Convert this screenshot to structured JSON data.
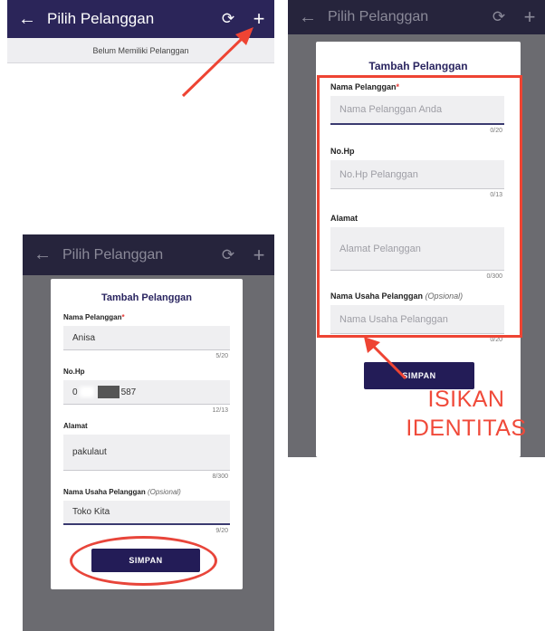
{
  "appbar": {
    "title": "Pilih Pelanggan",
    "back_icon": "←",
    "refresh_icon": "⟳",
    "add_icon": "+"
  },
  "empty_state": "Belum Memiliki Pelanggan",
  "dialog": {
    "title": "Tambah Pelanggan",
    "fields": [
      {
        "label": "Nama Pelanggan",
        "required_mark": "*",
        "placeholder": "Nama Pelanggan Anda",
        "counter_empty": "0/20"
      },
      {
        "label": "No.Hp",
        "placeholder": "No.Hp Pelanggan",
        "counter_empty": "0/13"
      },
      {
        "label": "Alamat",
        "placeholder": "Alamat Pelanggan",
        "counter_empty": "0/300"
      },
      {
        "label": "Nama Usaha Pelanggan",
        "optional_note": "(Opsional)",
        "placeholder": "Nama Usaha Pelanggan",
        "counter_empty": "0/20"
      }
    ],
    "submit_label": "SIMPAN"
  },
  "filled": {
    "name_value": "Anisa",
    "name_counter": "5/20",
    "phone_prefix": "0",
    "phone_suffix": "587",
    "phone_counter": "12/13",
    "address_value": "pakulaut",
    "address_counter": "8/300",
    "business_value": "Toko Kita",
    "business_counter": "9/20"
  },
  "annotation": {
    "line1": "ISIKAN",
    "line2": "IDENTITAS"
  },
  "colors": {
    "appbar": "#2b2559",
    "button": "#231c57",
    "highlight": "#ee4433"
  }
}
